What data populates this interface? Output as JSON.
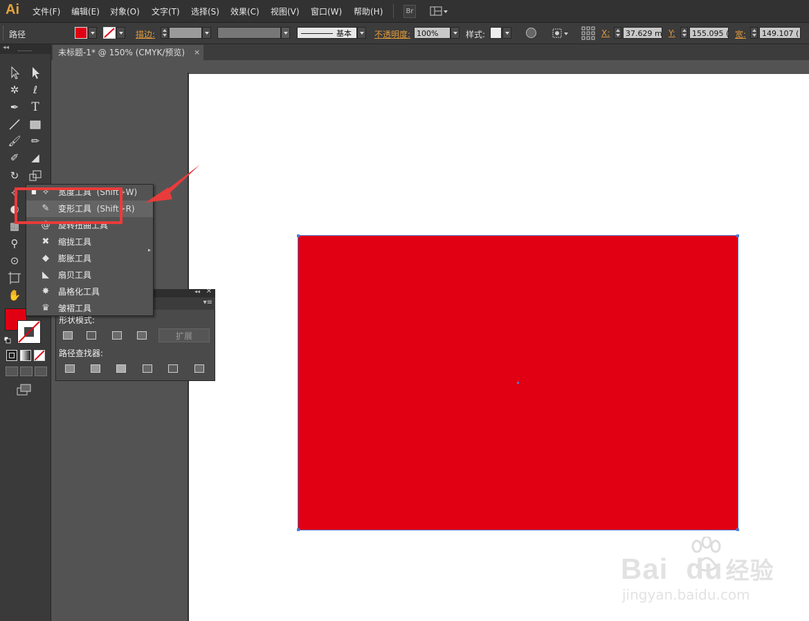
{
  "app": {
    "logo": "Ai"
  },
  "menu": [
    {
      "label": "文件(F)"
    },
    {
      "label": "编辑(E)"
    },
    {
      "label": "对象(O)"
    },
    {
      "label": "文字(T)"
    },
    {
      "label": "选择(S)"
    },
    {
      "label": "效果(C)"
    },
    {
      "label": "视图(V)"
    },
    {
      "label": "窗口(W)"
    },
    {
      "label": "帮助(H)"
    }
  ],
  "menubar_extra": {
    "bridge_label": "Br"
  },
  "control": {
    "selection_label": "路径",
    "stroke_label": "描边:",
    "stroke_style": "基本",
    "opacity_label": "不透明度:",
    "opacity_value": "100%",
    "style_label": "样式:",
    "x_label": "X:",
    "x_value": "37.629 m",
    "y_label": "Y:",
    "y_value": "155.095 (",
    "w_label": "宽:",
    "w_value": "149.107 ("
  },
  "document": {
    "tab_title": "未标题-1* @ 150% (CMYK/预览)",
    "close": "×"
  },
  "flyout": {
    "items": [
      {
        "icon": "width-tool-icon",
        "glyph": "⟡",
        "label": "宽度工具",
        "shortcut": "(Shift+W)"
      },
      {
        "icon": "warp-tool-icon",
        "glyph": "✎",
        "label": "变形工具",
        "shortcut": "(Shift+R)"
      },
      {
        "icon": "twirl-tool-icon",
        "glyph": "@",
        "label": "旋转扭曲工具",
        "shortcut": ""
      },
      {
        "icon": "pucker-tool-icon",
        "glyph": "✖",
        "label": "缩拢工具",
        "shortcut": ""
      },
      {
        "icon": "bloat-tool-icon",
        "glyph": "◆",
        "label": "膨胀工具",
        "shortcut": ""
      },
      {
        "icon": "scallop-tool-icon",
        "glyph": "◣",
        "label": "扇贝工具",
        "shortcut": ""
      },
      {
        "icon": "crystallize-tool-icon",
        "glyph": "✸",
        "label": "晶格化工具",
        "shortcut": ""
      },
      {
        "icon": "wrinkle-tool-icon",
        "glyph": "♛",
        "label": "皱褶工具",
        "shortcut": ""
      }
    ]
  },
  "pathfinder": {
    "shape_modes_label": "形状模式:",
    "expand_label": "扩展",
    "pathfinders_label": "路径查找器:"
  },
  "colors": {
    "fill": "#e10013",
    "accent": "#e39b3a",
    "highlight": "#ea3b3b",
    "selection": "#4d7bd8"
  },
  "watermark": {
    "brand": "Bai",
    "brand2": "du",
    "sub": "经验",
    "url": "jingyan.baidu.com"
  }
}
